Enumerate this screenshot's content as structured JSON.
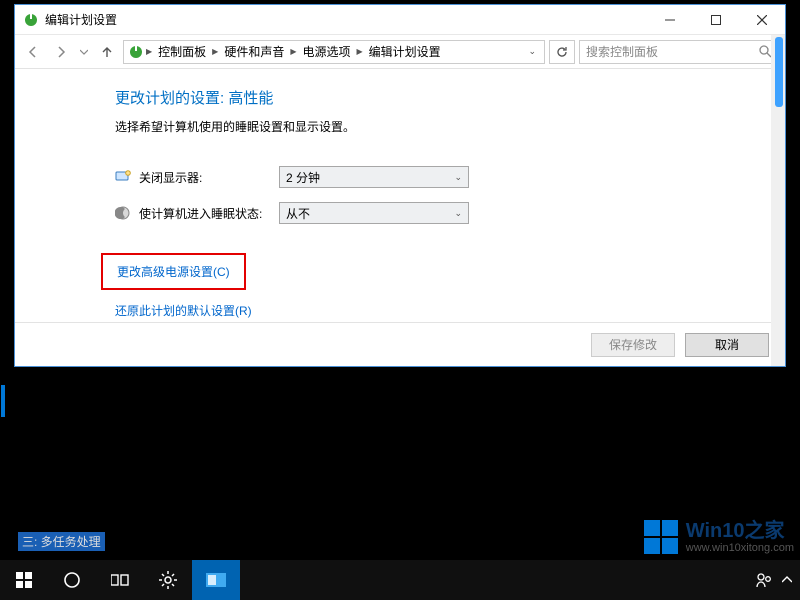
{
  "titlebar": {
    "title": "编辑计划设置"
  },
  "breadcrumb": {
    "items": [
      "控制面板",
      "硬件和声音",
      "电源选项",
      "编辑计划设置"
    ]
  },
  "search": {
    "placeholder": "搜索控制面板"
  },
  "heading": "更改计划的设置: 高性能",
  "subtext": "选择希望计算机使用的睡眠设置和显示设置。",
  "settings": {
    "display_off": {
      "label": "关闭显示器:",
      "value": "2 分钟"
    },
    "sleep": {
      "label": "使计算机进入睡眠状态:",
      "value": "从不"
    }
  },
  "links": {
    "advanced": "更改高级电源设置(C)",
    "restore": "还原此计划的默认设置(R)"
  },
  "footer": {
    "save": "保存修改",
    "cancel": "取消"
  },
  "desktop": {
    "label": "三: 多任务处理"
  },
  "watermark": {
    "big": "Win10之家",
    "small": "www.win10xitong.com"
  }
}
